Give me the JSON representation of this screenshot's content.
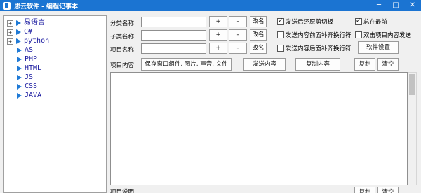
{
  "window": {
    "title": "思云软件 - 编程记事本",
    "minimize": "─",
    "maximize": "□",
    "close": "✕"
  },
  "tree": {
    "items": [
      {
        "label": "易语言",
        "expander": "+"
      },
      {
        "label": "C#",
        "expander": "+"
      },
      {
        "label": "python",
        "expander": "+"
      },
      {
        "label": "AS",
        "expander": ""
      },
      {
        "label": "PHP",
        "expander": ""
      },
      {
        "label": "HTML",
        "expander": ""
      },
      {
        "label": "JS",
        "expander": ""
      },
      {
        "label": "CSS",
        "expander": ""
      },
      {
        "label": "JAVA",
        "expander": ""
      }
    ]
  },
  "form": {
    "category_label": "分类名称:",
    "subcategory_label": "子类名称:",
    "item_label": "项目名称:",
    "content_label": "项目内容:",
    "note_label": "项目说明:",
    "category_value": "",
    "subcategory_value": "",
    "item_value": "",
    "plus": "+",
    "minus": "-",
    "rename": "改名",
    "save_widget": "保存窗口组件, 图片, 声音, 文件",
    "send_content": "发送内容",
    "copy_content": "复制内容",
    "copy": "复制",
    "clear": "清空",
    "settings": "软件设置"
  },
  "options": {
    "restore_clipboard": {
      "label": "发送后还原剪切板",
      "checked": true
    },
    "always_on_top": {
      "label": "总在最前",
      "checked": true
    },
    "newline_before": {
      "label": "发送内容前面补齐换行符",
      "checked": false
    },
    "dblclick_send": {
      "label": "双击项目内容发送",
      "checked": false
    },
    "newline_after": {
      "label": "发送内容后面补齐换行符",
      "checked": false
    }
  }
}
